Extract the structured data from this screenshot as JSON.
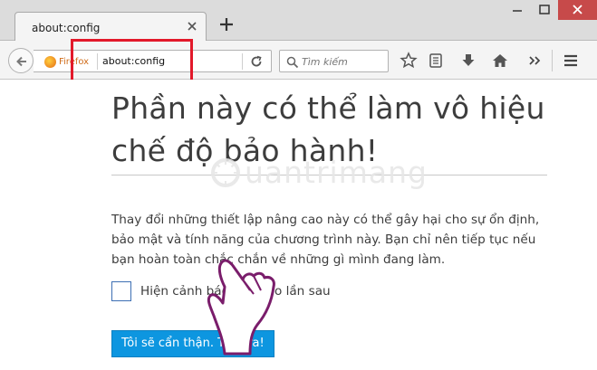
{
  "tab": {
    "title": "about:config"
  },
  "navbar": {
    "identity_label": "Firefox",
    "url": "about:config",
    "search_placeholder": "Tìm kiếm"
  },
  "content": {
    "title": "Phần này có thể làm vô hiệu chế độ bảo hành!",
    "description": "Thay đổi những thiết lập nâng cao này có thể gây hại cho sự ổn định, bảo mật và tính năng của chương trình này. Bạn chỉ nên tiếp tục nếu bạn hoàn toàn chắc chắn về những gì mình đang làm.",
    "checkbox_label": "Hiện cảnh báo này vào lần sau",
    "checkbox_checked": false,
    "accept_button": "Tôi sẽ cẩn thận. Tôi hứa!",
    "watermark_text": "uantrimang"
  },
  "colors": {
    "accent_button": "#0d96e0",
    "highlight_box": "#e2192a",
    "close_button": "#c74a4a"
  },
  "icons": [
    "back-arrow-icon",
    "firefox-icon",
    "reload-icon",
    "search-icon",
    "bookmark-star-icon",
    "reading-list-icon",
    "download-icon",
    "home-icon",
    "overflow-chevron-icon",
    "hamburger-menu-icon",
    "close-icon",
    "plus-icon",
    "minimize-icon",
    "maximize-icon",
    "pointing-hand-icon"
  ]
}
